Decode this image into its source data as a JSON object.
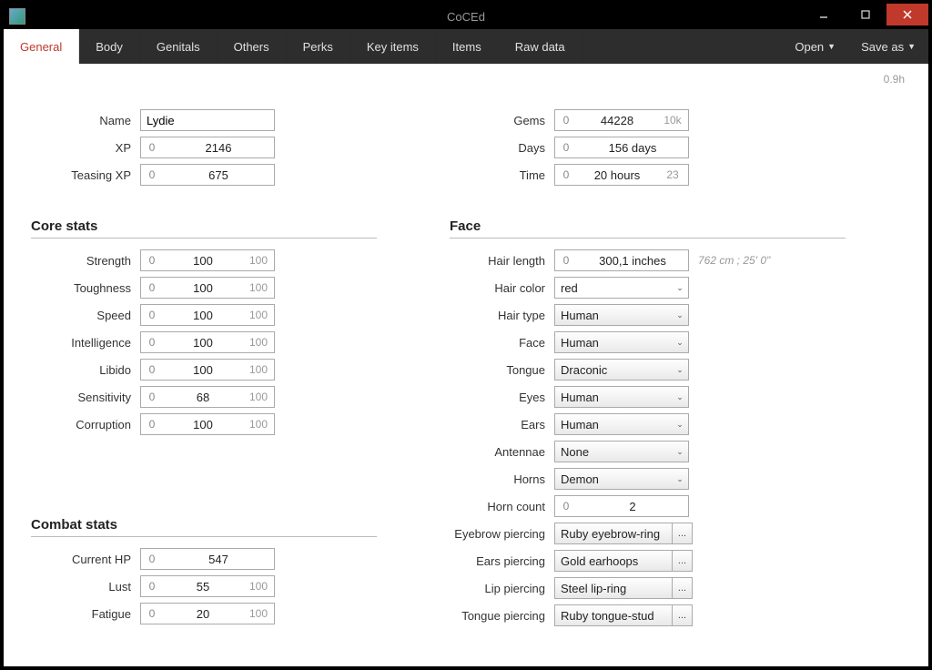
{
  "title": "CoCEd",
  "version": "0.9h",
  "tabs": [
    "General",
    "Body",
    "Genitals",
    "Others",
    "Perks",
    "Key items",
    "Items",
    "Raw data"
  ],
  "activeTab": "General",
  "menuRight": {
    "open": "Open",
    "saveas": "Save as"
  },
  "basics": {
    "name_label": "Name",
    "name_value": "Lydie",
    "xp_label": "XP",
    "xp_value": "2146",
    "txp_label": "Teasing XP",
    "txp_value": "675"
  },
  "basics2": {
    "gems_label": "Gems",
    "gems_value": "44228",
    "gems_max": "10k",
    "days_label": "Days",
    "days_value": "156 days",
    "time_label": "Time",
    "time_value": "20 hours",
    "time_max": "23"
  },
  "core": {
    "title": "Core stats",
    "rows": [
      {
        "label": "Strength",
        "min": "0",
        "val": "100",
        "max": "100"
      },
      {
        "label": "Toughness",
        "min": "0",
        "val": "100",
        "max": "100"
      },
      {
        "label": "Speed",
        "min": "0",
        "val": "100",
        "max": "100"
      },
      {
        "label": "Intelligence",
        "min": "0",
        "val": "100",
        "max": "100"
      },
      {
        "label": "Libido",
        "min": "0",
        "val": "100",
        "max": "100"
      },
      {
        "label": "Sensitivity",
        "min": "0",
        "val": "68",
        "max": "100"
      },
      {
        "label": "Corruption",
        "min": "0",
        "val": "100",
        "max": "100"
      }
    ]
  },
  "combat": {
    "title": "Combat stats",
    "rows": [
      {
        "label": "Current HP",
        "min": "0",
        "val": "547",
        "max": ""
      },
      {
        "label": "Lust",
        "min": "0",
        "val": "55",
        "max": "100"
      },
      {
        "label": "Fatigue",
        "min": "0",
        "val": "20",
        "max": "100"
      }
    ]
  },
  "face": {
    "title": "Face",
    "hairlen_label": "Hair length",
    "hairlen_val": "300,1 inches",
    "hairlen_note": "762 cm ; 25' 0\"",
    "haircolor_label": "Hair color",
    "haircolor_val": "red",
    "rows": [
      {
        "label": "Hair type",
        "val": "Human"
      },
      {
        "label": "Face",
        "val": "Human"
      },
      {
        "label": "Tongue",
        "val": "Draconic"
      },
      {
        "label": "Eyes",
        "val": "Human"
      },
      {
        "label": "Ears",
        "val": "Human"
      },
      {
        "label": "Antennae",
        "val": "None"
      },
      {
        "label": "Horns",
        "val": "Demon"
      }
    ],
    "horncount_label": "Horn count",
    "horncount_val": "2",
    "piercings": [
      {
        "label": "Eyebrow piercing",
        "val": "Ruby eyebrow-ring"
      },
      {
        "label": "Ears piercing",
        "val": "Gold earhoops"
      },
      {
        "label": "Lip piercing",
        "val": "Steel lip-ring"
      },
      {
        "label": "Tongue piercing",
        "val": "Ruby tongue-stud"
      }
    ]
  },
  "zero": "0"
}
